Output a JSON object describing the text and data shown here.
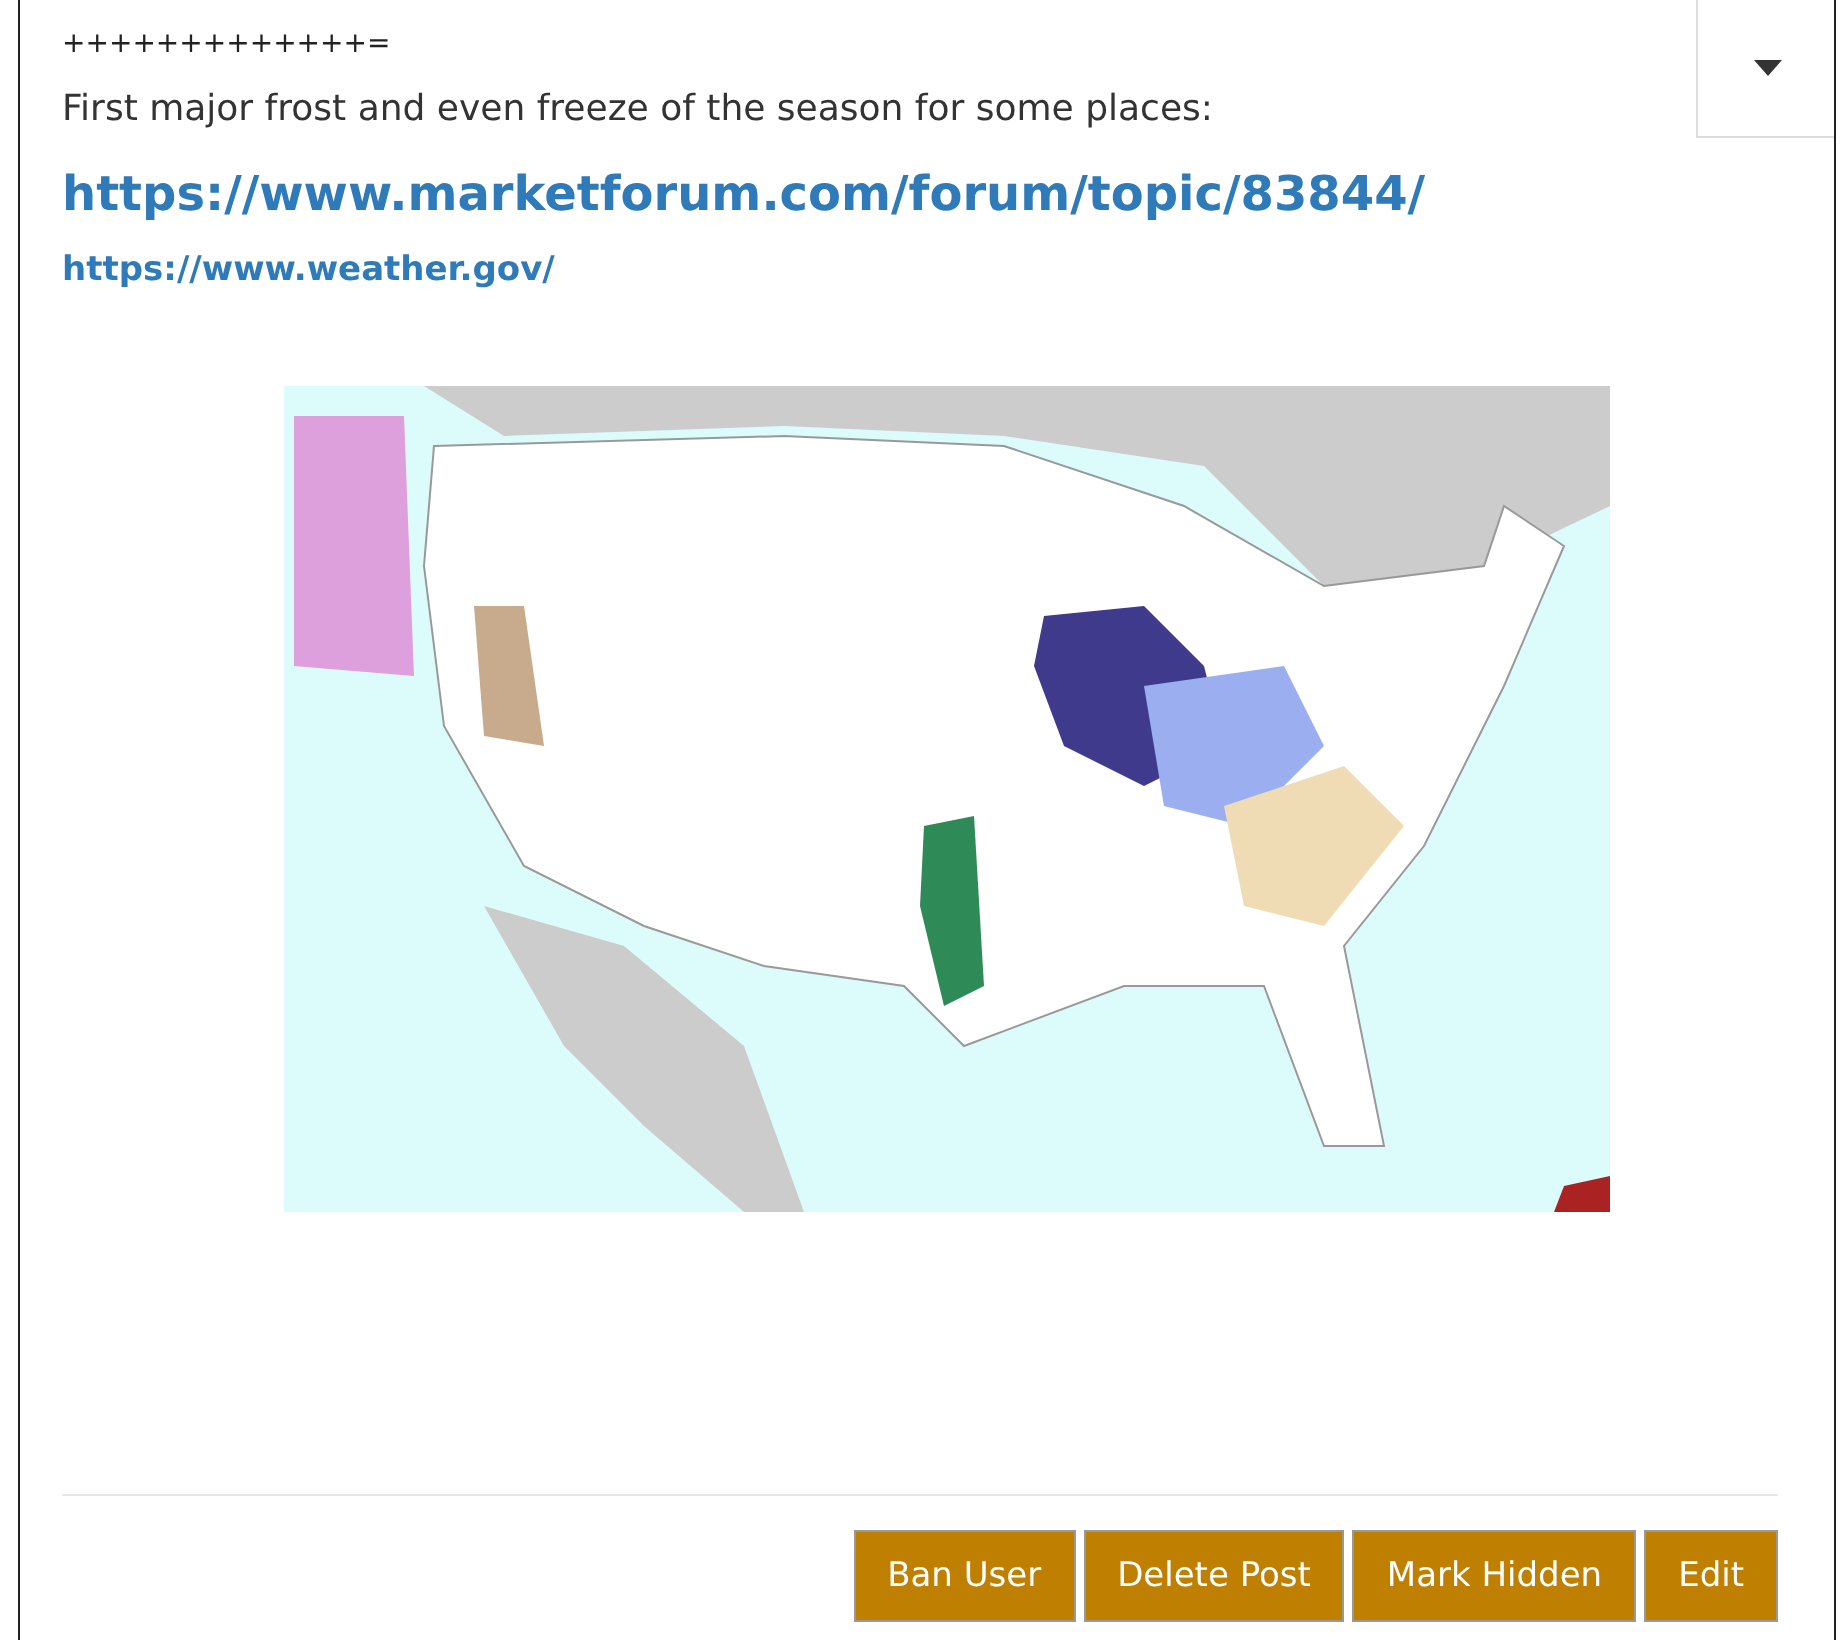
{
  "post": {
    "separator_line": "+++++++++++++=",
    "text": "First major frost and even freeze of the season for some places:",
    "links": [
      {
        "kind": "large",
        "text": "https://www.marketforum.com/forum/topic/83844/"
      },
      {
        "kind": "small",
        "text": "https://www.weather.gov/"
      }
    ]
  },
  "buttons": [
    "Ban User",
    "Delete Post",
    "Mark Hidden",
    "Edit"
  ]
}
